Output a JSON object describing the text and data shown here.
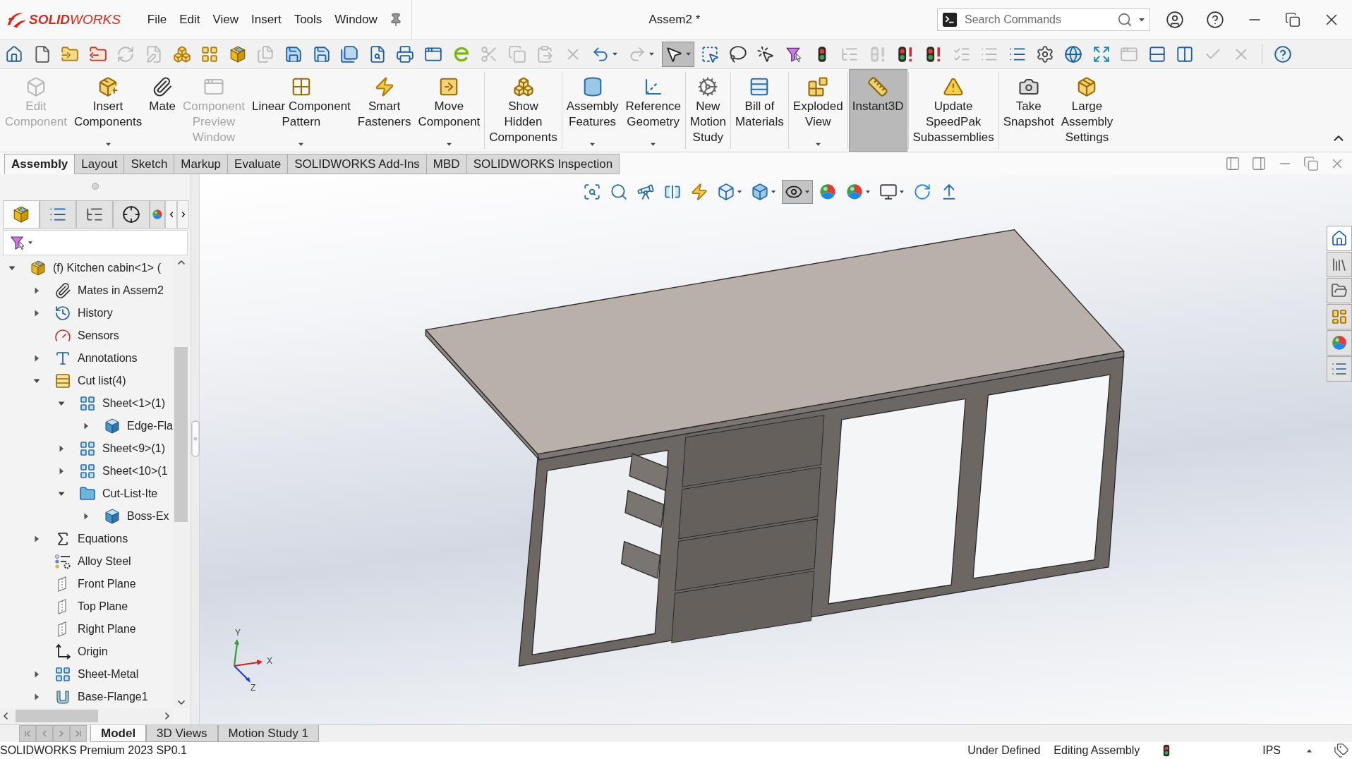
{
  "title_bar": {
    "logo": "**SOLID**WORKS",
    "menu": [
      "File",
      "Edit",
      "View",
      "Insert",
      "Tools",
      "Window"
    ],
    "title": "Assem2 *",
    "search": {
      "placeholder": "Search Commands"
    }
  },
  "quick_toolbar": [
    [
      {
        "disabled": false,
        "on": false,
        "menu": false
      },
      {
        "disabled": false,
        "on": false,
        "menu": false
      },
      {
        "disabled": false,
        "on": false,
        "menu": false
      },
      {
        "disabled": false,
        "on": false,
        "menu": false
      },
      {
        "disabled": true,
        "on": false,
        "menu": false
      },
      {
        "disabled": true,
        "on": false,
        "menu": false
      },
      {
        "disabled": false,
        "on": false,
        "menu": false
      },
      {
        "disabled": false,
        "on": false,
        "menu": false
      },
      {
        "disabled": false,
        "on": false,
        "menu": false
      },
      {
        "disabled": true,
        "on": false,
        "menu": false
      },
      {
        "disabled": false,
        "on": false,
        "menu": false
      },
      {
        "disabled": false,
        "on": false,
        "menu": false
      },
      {
        "disabled": false,
        "on": false,
        "menu": false
      },
      {
        "disabled": false,
        "on": false,
        "menu": false
      },
      {
        "disabled": false,
        "on": false,
        "menu": false
      },
      {
        "disabled": false,
        "on": false,
        "menu": false
      },
      {
        "disabled": false,
        "on": false,
        "menu": false
      },
      {
        "disabled": true,
        "on": false,
        "menu": false
      },
      {
        "disabled": true,
        "on": false,
        "menu": false
      },
      {
        "disabled": true,
        "on": false,
        "menu": false
      },
      {
        "disabled": true,
        "on": false,
        "menu": false
      },
      {
        "disabled": false,
        "on": false,
        "menu": true
      },
      {
        "disabled": true,
        "on": false,
        "menu": true
      },
      {
        "disabled": false,
        "on": true,
        "menu": true
      },
      {
        "disabled": false,
        "on": false,
        "menu": false
      },
      {
        "disabled": false,
        "on": false,
        "menu": false
      },
      {
        "disabled": false,
        "on": false,
        "menu": false
      },
      {
        "disabled": false,
        "on": false,
        "menu": false
      },
      {
        "disabled": false,
        "on": false,
        "menu": false
      },
      {
        "disabled": true,
        "on": false,
        "menu": false
      },
      {
        "disabled": true,
        "on": false,
        "menu": false
      },
      {
        "disabled": false,
        "on": false,
        "menu": false
      },
      {
        "disabled": false,
        "on": false,
        "menu": false
      },
      {
        "disabled": true,
        "on": false,
        "menu": false
      },
      {
        "disabled": true,
        "on": false,
        "menu": false
      },
      {
        "disabled": false,
        "on": false,
        "menu": false
      },
      {
        "disabled": false,
        "on": false,
        "menu": false
      },
      {
        "disabled": false,
        "on": false,
        "menu": false
      },
      {
        "disabled": false,
        "on": false,
        "menu": false
      },
      {
        "disabled": true,
        "on": false,
        "menu": false
      },
      {
        "disabled": false,
        "on": false,
        "menu": false
      },
      {
        "disabled": false,
        "on": false,
        "menu": false
      },
      {
        "disabled": true,
        "on": false,
        "menu": false
      },
      {
        "disabled": true,
        "on": false,
        "menu": false
      }
    ],
    [
      {
        "disabled": false,
        "on": false,
        "menu": false
      }
    ]
  ],
  "ribbon": [
    [
      {
        "label": "Edit\nComponent",
        "disabled": true,
        "on": false,
        "menu": false
      },
      {
        "label": "Insert\nComponents",
        "disabled": false,
        "on": false,
        "menu": true
      },
      {
        "label": "Mate",
        "disabled": false,
        "on": false,
        "menu": false
      },
      {
        "label": "Component\nPreview\nWindow",
        "disabled": true,
        "on": false,
        "menu": false
      },
      {
        "label": "Linear Component\nPattern",
        "disabled": false,
        "on": false,
        "menu": true
      },
      {
        "label": "Smart\nFasteners",
        "disabled": false,
        "on": false,
        "menu": false
      },
      {
        "label": "Move\nComponent",
        "disabled": false,
        "on": false,
        "menu": true
      }
    ],
    [
      {
        "label": "Show\nHidden\nComponents",
        "disabled": false,
        "on": false,
        "menu": false
      }
    ],
    [
      {
        "label": "Assembly\nFeatures",
        "disabled": false,
        "on": false,
        "menu": true
      },
      {
        "label": "Reference\nGeometry",
        "disabled": false,
        "on": false,
        "menu": true
      }
    ],
    [
      {
        "label": "New\nMotion\nStudy",
        "disabled": false,
        "on": false,
        "menu": false
      }
    ],
    [
      {
        "label": "Bill of\nMaterials",
        "disabled": false,
        "on": false,
        "menu": false
      }
    ],
    [
      {
        "label": "Exploded\nView",
        "disabled": false,
        "on": false,
        "menu": true
      }
    ],
    [
      {
        "label": "Instant3D",
        "disabled": false,
        "on": true,
        "menu": false
      }
    ],
    [
      {
        "label": "Update\nSpeedPak\nSubassemblies",
        "disabled": false,
        "on": false,
        "menu": false
      }
    ],
    [
      {
        "label": "Take\nSnapshot",
        "disabled": false,
        "on": false,
        "menu": false
      },
      {
        "label": "Large\nAssembly\nSettings",
        "disabled": false,
        "on": false,
        "menu": false
      }
    ]
  ],
  "command_tabs": [
    {
      "label": "Assembly",
      "selected": true
    },
    {
      "label": "Layout",
      "selected": false
    },
    {
      "label": "Sketch",
      "selected": false
    },
    {
      "label": "Markup",
      "selected": false
    },
    {
      "label": "Evaluate",
      "selected": false
    },
    {
      "label": "SOLIDWORKS Add-Ins",
      "selected": false
    },
    {
      "label": "MBD",
      "selected": false
    },
    {
      "label": "SOLIDWORKS Inspection",
      "selected": false
    }
  ],
  "feature_manager": {
    "panel_tabs": [
      {
        "selected": true
      },
      {
        "selected": false
      },
      {
        "selected": false
      },
      {
        "selected": false
      },
      {
        "selected": false
      }
    ],
    "tree": [
      {
        "label": "(f) Kitchen cabin<1> (",
        "kind": "component",
        "expanded": true,
        "children": [
          {
            "label": "Mates in Assem2",
            "kind": "mates",
            "expanded": false
          },
          {
            "label": "History",
            "kind": "history",
            "expanded": false
          },
          {
            "label": "Sensors",
            "kind": "sensors"
          },
          {
            "label": "Annotations",
            "kind": "annotations",
            "expanded": false
          },
          {
            "label": "Cut list(4)",
            "kind": "cutlist",
            "expanded": true,
            "children": [
              {
                "label": "Sheet<1>(1)",
                "kind": "sheet",
                "expanded": true,
                "children": [
                  {
                    "label": "Edge-Fla",
                    "kind": "body",
                    "expanded": false
                  }
                ]
              },
              {
                "label": "Sheet<9>(1)",
                "kind": "sheet",
                "expanded": false
              },
              {
                "label": "Sheet<10>(1",
                "kind": "sheet",
                "expanded": false
              },
              {
                "label": "Cut-List-Ite",
                "kind": "folder",
                "expanded": true,
                "children": [
                  {
                    "label": "Boss-Ex",
                    "kind": "body",
                    "expanded": false
                  }
                ]
              }
            ]
          },
          {
            "label": "Equations",
            "kind": "equations",
            "expanded": false
          },
          {
            "label": "Alloy Steel",
            "kind": "material"
          },
          {
            "label": "Front Plane",
            "kind": "plane"
          },
          {
            "label": "Top Plane",
            "kind": "plane"
          },
          {
            "label": "Right Plane",
            "kind": "plane"
          },
          {
            "label": "Origin",
            "kind": "origin"
          },
          {
            "label": "Sheet-Metal",
            "kind": "sheetmetal",
            "expanded": false
          },
          {
            "label": "Base-Flange1",
            "kind": "flange",
            "expanded": false
          }
        ]
      }
    ]
  },
  "view_toolbar": [
    {
      "on": false,
      "menu": false
    },
    {
      "on": false,
      "menu": false
    },
    {
      "on": false,
      "menu": false
    },
    {
      "on": false,
      "menu": false
    },
    {
      "on": false,
      "menu": false
    },
    {
      "on": false,
      "menu": true
    },
    {
      "on": false,
      "menu": true
    },
    {
      "on": true,
      "menu": true
    },
    {
      "on": false,
      "menu": false
    },
    {
      "on": false,
      "menu": true
    },
    {
      "on": false,
      "menu": true
    },
    {
      "on": false,
      "menu": false
    },
    {
      "on": false,
      "menu": false
    }
  ],
  "task_pane": [
    {
      "selected": true
    },
    {
      "selected": false
    },
    {
      "selected": false
    },
    {
      "selected": false
    },
    {
      "selected": false
    },
    {
      "selected": false
    }
  ],
  "triad": {
    "y_label": "Y",
    "x_label": "X",
    "z_label": "Z"
  },
  "model_tabs": [
    {
      "label": "Model",
      "selected": true
    },
    {
      "label": "3D Views",
      "selected": false
    },
    {
      "label": "Motion Study 1",
      "selected": false
    }
  ],
  "status_bar": {
    "product": "SOLIDWORKS Premium 2023 SP0.1",
    "state": "Under Defined",
    "mode": "Editing Assembly",
    "units": "IPS"
  }
}
